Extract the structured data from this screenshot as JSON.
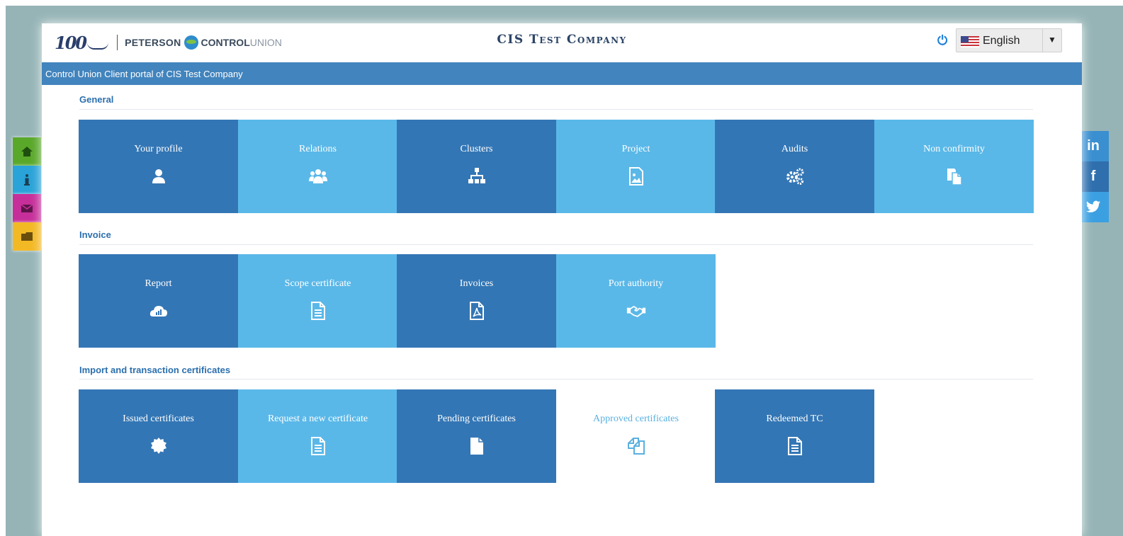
{
  "header": {
    "logo_anniversary": "100",
    "logo_peterson": "PETERSON",
    "logo_control": "CONTROL",
    "logo_union": "UNION",
    "company_title": "CIS Test Company",
    "power_symbol": "⏻",
    "language": "English",
    "language_arrow": "▼"
  },
  "subbar": {
    "text": "Control Union Client portal of CIS Test Company"
  },
  "sections": {
    "general": {
      "title": "General",
      "tiles": [
        {
          "label": "Your profile",
          "icon": "user-icon"
        },
        {
          "label": "Relations",
          "icon": "users-icon"
        },
        {
          "label": "Clusters",
          "icon": "sitemap-icon"
        },
        {
          "label": "Project",
          "icon": "image-file-icon"
        },
        {
          "label": "Audits",
          "icon": "gears-icon"
        },
        {
          "label": "Non confirmity",
          "icon": "copy-files-icon"
        }
      ]
    },
    "invoice": {
      "title": "Invoice",
      "tiles": [
        {
          "label": "Report",
          "icon": "cloud-chart-icon"
        },
        {
          "label": "Scope certificate",
          "icon": "document-icon"
        },
        {
          "label": "Invoices",
          "icon": "pdf-file-icon"
        },
        {
          "label": "Port authority",
          "icon": "handshake-icon"
        }
      ]
    },
    "import": {
      "title": "Import and transaction certificates",
      "tiles": [
        {
          "label": "Issued certificates",
          "icon": "certificate-badge-icon"
        },
        {
          "label": "Request a new certificate",
          "icon": "document-icon"
        },
        {
          "label": "Pending certificates",
          "icon": "file-icon"
        },
        {
          "label": "Approved certificates",
          "icon": "copy-outline-icon"
        },
        {
          "label": "Redeemed TC",
          "icon": "document-icon"
        }
      ]
    }
  },
  "left_nav": [
    {
      "name": "home-icon",
      "color": "#5aa82a"
    },
    {
      "name": "info-icon",
      "color": "#29a3d8"
    },
    {
      "name": "mail-icon",
      "color": "#c62f9a"
    },
    {
      "name": "folder-icon",
      "color": "#f3b925"
    }
  ],
  "social": {
    "linkedin": "in",
    "facebook": "f",
    "twitter_icon": "twitter-icon"
  },
  "colors": {
    "tile_dark": "#3376b5",
    "tile_light": "#5ab8e8",
    "subbar": "#4284bd",
    "social_linkedin": "#3a8fd0",
    "social_facebook": "#2f6fae",
    "social_twitter": "#3ba0e2"
  }
}
